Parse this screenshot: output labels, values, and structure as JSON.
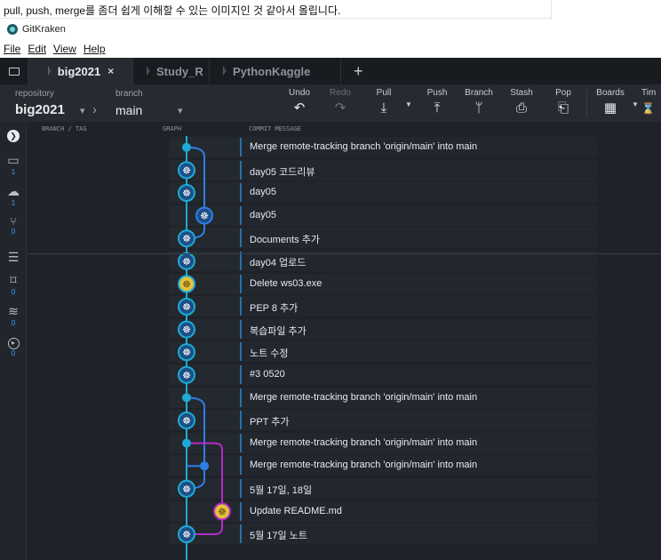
{
  "caption": "pull, push, merge를 좀더 쉽게 이해할 수 있는 이미지인 것 같아서 올립니다.",
  "window": {
    "title": "GitKraken",
    "icon": "gitkraken-logo-icon"
  },
  "menu": [
    "File",
    "Edit",
    "View",
    "Help"
  ],
  "tabs": [
    {
      "label": "big2021",
      "active": true,
      "close": "×"
    },
    {
      "label": "Study_R",
      "active": false
    },
    {
      "label": "PythonKaggle",
      "active": false
    }
  ],
  "new_tab": "+",
  "toolbar": {
    "repository_label": "repository",
    "repository": "big2021",
    "branch_label": "branch",
    "branch": "main",
    "buttons": [
      {
        "label": "Undo",
        "icon": "↶",
        "enabled": true
      },
      {
        "label": "Redo",
        "icon": "↷",
        "enabled": false
      },
      {
        "label": "Pull",
        "icon": "⤓",
        "enabled": true
      },
      {
        "label": "Push",
        "icon": "⤒",
        "enabled": true
      },
      {
        "label": "Branch",
        "icon": "ᛘ",
        "enabled": true
      },
      {
        "label": "Stash",
        "icon": "⎙",
        "enabled": true
      },
      {
        "label": "Pop",
        "icon": "⎗",
        "enabled": true
      },
      {
        "label": "Boards",
        "icon": "▦",
        "enabled": true
      },
      {
        "label": "Tim",
        "icon": "⌛",
        "enabled": true
      }
    ]
  },
  "sidebar": [
    {
      "icon": "expand-icon",
      "glyph": "❯",
      "count": ""
    },
    {
      "icon": "laptop-icon",
      "glyph": "▭",
      "count": "1"
    },
    {
      "icon": "cloud-icon",
      "glyph": "☁",
      "count": "1"
    },
    {
      "icon": "pull-request-icon",
      "glyph": "⑂",
      "count": "0"
    },
    {
      "icon": "list-icon",
      "glyph": "☰",
      "count": ""
    },
    {
      "icon": "tag-icon",
      "glyph": "⌑",
      "count": "0"
    },
    {
      "icon": "stack-icon",
      "glyph": "≋",
      "count": "0"
    },
    {
      "icon": "play-icon",
      "glyph": "▸",
      "count": "0"
    }
  ],
  "columns": {
    "branch": "BRANCH / TAG",
    "graph": "GRAPH",
    "message": "COMMIT MESSAGE"
  },
  "commits": [
    {
      "message": "Merge remote-tracking branch 'origin/main' into main"
    },
    {
      "message": "day05 코드리뷰"
    },
    {
      "message": "day05"
    },
    {
      "message": "day05"
    },
    {
      "message": "Documents 추가"
    },
    {
      "message": "day04 업로드"
    },
    {
      "message": "Delete ws03.exe"
    },
    {
      "message": "PEP 8 추가"
    },
    {
      "message": "복습파일 추가"
    },
    {
      "message": "노트 수정"
    },
    {
      "message": "#3 0520"
    },
    {
      "message": "Merge remote-tracking branch 'origin/main' into main"
    },
    {
      "message": "PPT 추가"
    },
    {
      "message": "Merge remote-tracking branch 'origin/main' into main"
    },
    {
      "message": "Merge remote-tracking branch 'origin/main' into main"
    },
    {
      "message": "5월 17일, 18일"
    },
    {
      "message": "Update README.md"
    },
    {
      "message": "5월 17일 노트"
    }
  ],
  "colors": {
    "lane1": "#1eaad6",
    "lane2": "#2f7ee8",
    "lane3": "#b42ac8",
    "avatarYellow": "#e0c43a"
  }
}
